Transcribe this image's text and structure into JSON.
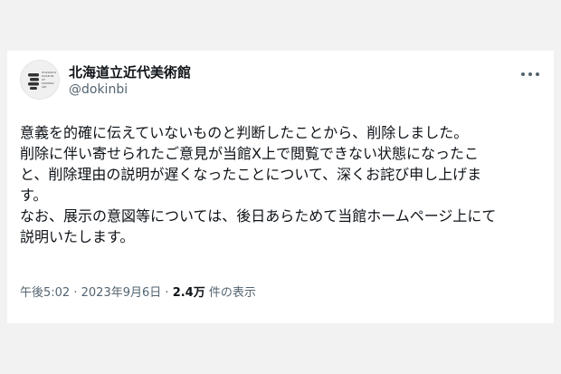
{
  "account": {
    "name": "北海道立近代美術館",
    "handle": "@dokinbi",
    "avatar_lines": [
      "HOKKAIDO",
      "MUSEUM",
      "OF",
      "MODERN",
      "ART"
    ]
  },
  "tweet": {
    "lines": [
      "意義を的確に伝えていないものと判断したことから、削除しました。",
      "削除に伴い寄せられたご意見が当館X上で閲覧できない状態になったこ",
      "と、削除理由の説明が遅くなったことについて、深くお詫び申し上げま",
      "す。",
      "なお、展示の意図等については、後日あらためて当館ホームページ上にて",
      "説明いたします。"
    ]
  },
  "meta": {
    "time": "午後5:02",
    "separator1": "·",
    "date": "2023年9月6日",
    "separator2": "·",
    "views": "2.4万",
    "views_suffix": "件の表示"
  },
  "icons": {
    "more": "more-horizontal-icon",
    "avatar_logo": "museum-logo"
  },
  "colors": {
    "text_primary": "#0f1419",
    "text_secondary": "#536471",
    "card_bg": "#ffffff",
    "page_bg": "#f2f2f2"
  }
}
